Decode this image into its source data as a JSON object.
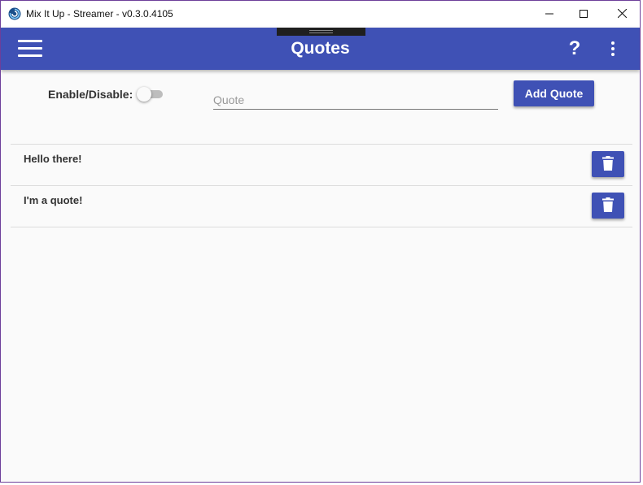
{
  "window": {
    "title": "Mix It Up - Streamer - v0.3.0.4105",
    "icon": "mixitup-logo-icon",
    "controls": [
      "minimize-icon",
      "maximize-icon",
      "close-icon"
    ]
  },
  "appbar": {
    "title": "Quotes",
    "menu_icon": "hamburger-menu-icon",
    "help_label": "?",
    "more_icon": "more-vert-icon",
    "color": "#3f51b5"
  },
  "controls": {
    "enable_label": "Enable/Disable:",
    "enabled": false,
    "quote_placeholder": "Quote",
    "quote_value": "",
    "add_button_label": "Add Quote"
  },
  "quotes": [
    {
      "text": "Hello there!",
      "delete_icon": "trash-icon"
    },
    {
      "text": "I'm a quote!",
      "delete_icon": "trash-icon"
    }
  ]
}
